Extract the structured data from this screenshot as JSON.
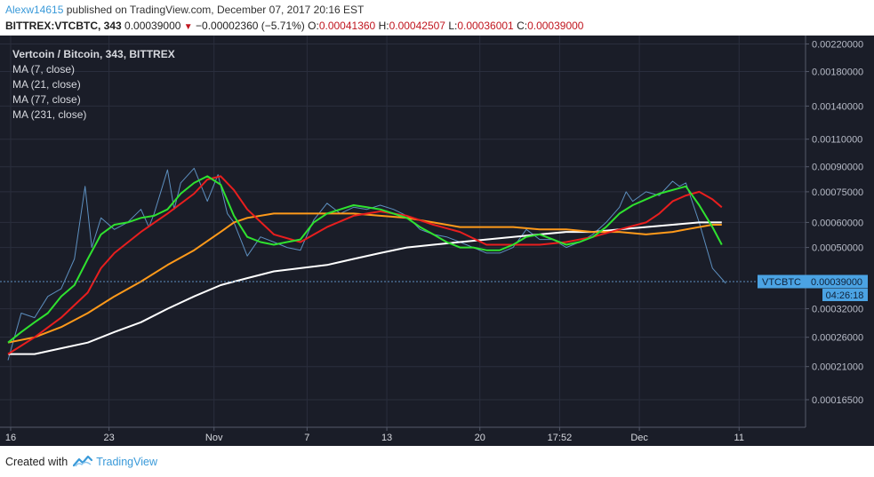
{
  "header": {
    "user": "Alexw14615",
    "published": "published on TradingView.com, December 07, 2017 20:16 EST",
    "symbol_line": "BITTREX:VTCBTC, 343",
    "last": "0.00039000",
    "change": "−0.00002360 (−5.71%)",
    "o_label": "O:",
    "o_value": "0.00041360",
    "h_label": "H:",
    "h_value": "0.00042507",
    "l_label": "L:",
    "l_value": "0.00036001",
    "c_label": "C:",
    "c_value": "0.00039000"
  },
  "legend": [
    "Vertcoin / Bitcoin, 343, BITTREX",
    "MA (7, close)",
    "MA (21, close)",
    "MA (77, close)",
    "MA (231, close)"
  ],
  "price_tag": {
    "symbol": "VTCBTC",
    "value": "0.00039000",
    "countdown": "04:26:18"
  },
  "footer": {
    "created_with": "Created with",
    "brand": "TradingView"
  },
  "colors": {
    "background": "#1a1d28",
    "grid": "#2a2e3d",
    "price": "#5d8fbf",
    "ma7": "#2fe22f",
    "ma21": "#e81e1e",
    "ma77": "#ff9a1a",
    "ma231": "#ffffff",
    "tag": "#4ba3e3"
  },
  "chart_data": {
    "type": "line",
    "scale": "log",
    "ylim": [
      0.000135,
      0.00234
    ],
    "y_ticks": [
      "0.00220000",
      "0.00180000",
      "0.00140000",
      "0.00110000",
      "0.00090000",
      "0.00075000",
      "0.00060000",
      "0.00050000",
      "0.00032000",
      "0.00026000",
      "0.00021000",
      "0.00016500"
    ],
    "x_ticks": [
      "16",
      "23",
      "Nov",
      "7",
      "13",
      "20",
      "17:52",
      "Dec",
      "11"
    ],
    "x_tick_pos": [
      0.2,
      7.6,
      15.5,
      22.5,
      28.5,
      35.5,
      41.5,
      47.5,
      55.0
    ],
    "xlim": [
      -0.2,
      60.0
    ],
    "series": [
      {
        "key": "price",
        "x": [
          0,
          1,
          2,
          3,
          4,
          5,
          5.8,
          6.3,
          7,
          8,
          9,
          10,
          10.6,
          11,
          12,
          12.5,
          13,
          14,
          15,
          15.8,
          16.5,
          17,
          18,
          19,
          20,
          21,
          22,
          23,
          24,
          25,
          26,
          27,
          28,
          29,
          30,
          31,
          32,
          33,
          34,
          35,
          36,
          37,
          38,
          39,
          40,
          41,
          42,
          43,
          44,
          45,
          46,
          46.5,
          47,
          48,
          49,
          50,
          50.5,
          51,
          52,
          53,
          54
        ],
        "y": [
          0.00022,
          0.00031,
          0.0003,
          0.00035,
          0.00037,
          0.00046,
          0.00078,
          0.0005,
          0.00062,
          0.00057,
          0.0006,
          0.00066,
          0.00058,
          0.00064,
          0.00088,
          0.00066,
          0.0008,
          0.00089,
          0.0007,
          0.00085,
          0.00064,
          0.0006,
          0.00047,
          0.00054,
          0.00052,
          0.0005,
          0.00049,
          0.00061,
          0.00069,
          0.00064,
          0.00067,
          0.00066,
          0.00068,
          0.00066,
          0.00063,
          0.00057,
          0.00055,
          0.00054,
          0.00052,
          0.0005,
          0.00048,
          0.00048,
          0.0005,
          0.00057,
          0.00053,
          0.00053,
          0.0005,
          0.00052,
          0.00055,
          0.0006,
          0.00067,
          0.00075,
          0.0007,
          0.00075,
          0.00073,
          0.00081,
          0.00078,
          0.0008,
          0.0006,
          0.00043,
          0.000385
        ]
      },
      {
        "key": "ma7",
        "x": [
          0,
          1,
          2,
          3,
          4,
          5,
          6,
          7,
          8,
          9,
          10,
          11,
          12,
          13,
          14,
          15,
          16,
          17,
          18,
          19,
          20,
          21,
          22,
          23,
          24,
          25,
          26,
          27,
          28,
          29,
          30,
          31,
          32,
          33,
          34,
          35,
          36,
          37,
          38,
          39,
          40,
          41,
          42,
          43,
          44,
          45,
          46,
          47,
          48,
          49,
          50,
          51,
          52,
          53,
          53.7
        ],
        "y": [
          0.00025,
          0.00027,
          0.00029,
          0.00031,
          0.00035,
          0.00038,
          0.00046,
          0.00055,
          0.00059,
          0.0006,
          0.00062,
          0.00063,
          0.00066,
          0.00074,
          0.0008,
          0.00084,
          0.00079,
          0.00063,
          0.00054,
          0.00052,
          0.00051,
          0.00052,
          0.00053,
          0.0006,
          0.00064,
          0.00066,
          0.00068,
          0.00067,
          0.00066,
          0.00064,
          0.00062,
          0.00058,
          0.00055,
          0.00052,
          0.0005,
          0.0005,
          0.00049,
          0.00049,
          0.00051,
          0.00054,
          0.00055,
          0.00053,
          0.00051,
          0.00052,
          0.00054,
          0.00058,
          0.00064,
          0.00068,
          0.00071,
          0.00074,
          0.00076,
          0.00078,
          0.00068,
          0.00058,
          0.00051
        ]
      },
      {
        "key": "ma21",
        "x": [
          0,
          2,
          4,
          6,
          7,
          8,
          10,
          12,
          14,
          15,
          16,
          17,
          18,
          20,
          22,
          24,
          26,
          28,
          30,
          32,
          34,
          36,
          38,
          40,
          42,
          44,
          46,
          48,
          49,
          50,
          51,
          52,
          53,
          53.7
        ],
        "y": [
          0.00023,
          0.00026,
          0.0003,
          0.00036,
          0.00043,
          0.00048,
          0.00056,
          0.00064,
          0.00074,
          0.00082,
          0.00084,
          0.00076,
          0.00066,
          0.00055,
          0.00052,
          0.00058,
          0.00063,
          0.00065,
          0.00063,
          0.00059,
          0.00056,
          0.00051,
          0.00051,
          0.00051,
          0.00052,
          0.00054,
          0.00057,
          0.0006,
          0.00064,
          0.0007,
          0.00073,
          0.00075,
          0.00071,
          0.00067
        ]
      },
      {
        "key": "ma77",
        "x": [
          0,
          2,
          4,
          6,
          8,
          10,
          12,
          14,
          16,
          17,
          18,
          20,
          22,
          24,
          26,
          28,
          30,
          32,
          34,
          36,
          38,
          40,
          42,
          44,
          46,
          48,
          50,
          51,
          52,
          53,
          53.7
        ],
        "y": [
          0.00025,
          0.00026,
          0.00028,
          0.00031,
          0.00035,
          0.00039,
          0.00044,
          0.00049,
          0.00056,
          0.0006,
          0.00062,
          0.00064,
          0.00064,
          0.00064,
          0.00064,
          0.00063,
          0.00062,
          0.0006,
          0.00058,
          0.00058,
          0.00058,
          0.00057,
          0.00057,
          0.00056,
          0.00056,
          0.00055,
          0.00056,
          0.00057,
          0.00058,
          0.00059,
          0.00059
        ]
      },
      {
        "key": "ma231",
        "x": [
          0,
          2,
          4,
          6,
          8,
          10,
          12,
          14,
          16,
          18,
          20,
          22,
          24,
          26,
          28,
          30,
          32,
          34,
          36,
          38,
          40,
          42,
          44,
          46,
          48,
          50,
          52,
          53,
          53.7
        ],
        "y": [
          0.00023,
          0.00023,
          0.00024,
          0.00025,
          0.00027,
          0.00029,
          0.00032,
          0.00035,
          0.00038,
          0.0004,
          0.00042,
          0.00043,
          0.00044,
          0.00046,
          0.00048,
          0.0005,
          0.00051,
          0.00052,
          0.00053,
          0.00054,
          0.00055,
          0.00056,
          0.00056,
          0.00057,
          0.00058,
          0.00059,
          0.0006,
          0.0006,
          0.0006
        ]
      }
    ]
  }
}
